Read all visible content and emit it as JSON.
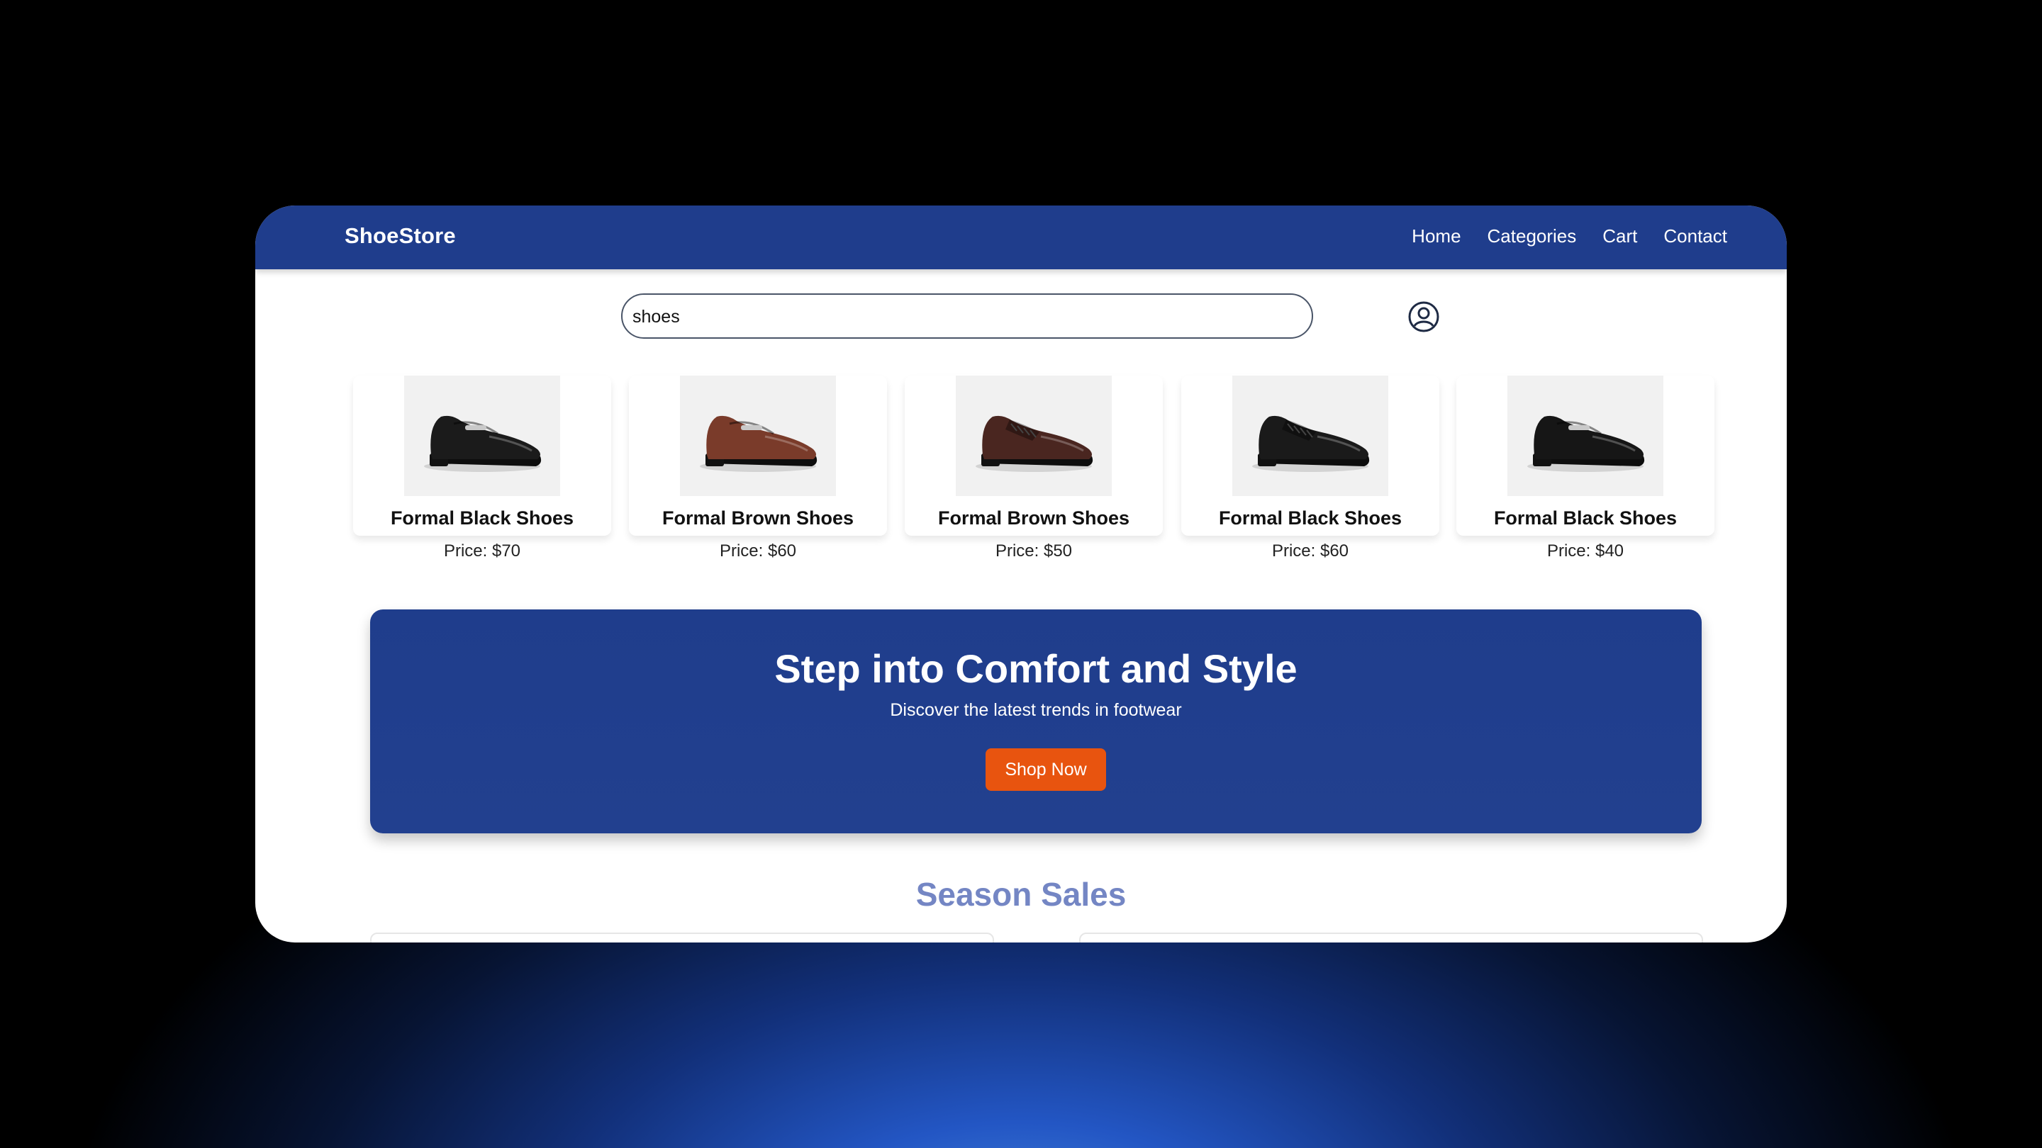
{
  "header": {
    "logo": "ShoeStore",
    "nav": [
      "Home",
      "Categories",
      "Cart",
      "Contact"
    ]
  },
  "search": {
    "value": "shoes",
    "placeholder": "Search"
  },
  "user_icon": "user-circle-icon",
  "products": [
    {
      "name": "Formal Black Shoes",
      "price": "Price: $70",
      "color": "#1b1b1b",
      "style": "loafer-buckle"
    },
    {
      "name": "Formal Brown Shoes",
      "price": "Price: $60",
      "color": "#7a3b2a",
      "style": "loafer-buckle"
    },
    {
      "name": "Formal Brown Shoes",
      "price": "Price: $50",
      "color": "#4a2620",
      "style": "derby-laced"
    },
    {
      "name": "Formal Black Shoes",
      "price": "Price: $60",
      "color": "#1a1a1a",
      "style": "derby-laced"
    },
    {
      "name": "Formal Black Shoes",
      "price": "Price: $40",
      "color": "#161616",
      "style": "loafer-buckle"
    }
  ],
  "hero": {
    "title": "Step into Comfort and Style",
    "subtitle": "Discover the latest trends in footwear",
    "button": "Shop Now"
  },
  "season": {
    "title": "Season Sales"
  },
  "colors": {
    "primary": "#1f3d8c",
    "accent": "#e8540f",
    "section_title": "#7486c4"
  }
}
